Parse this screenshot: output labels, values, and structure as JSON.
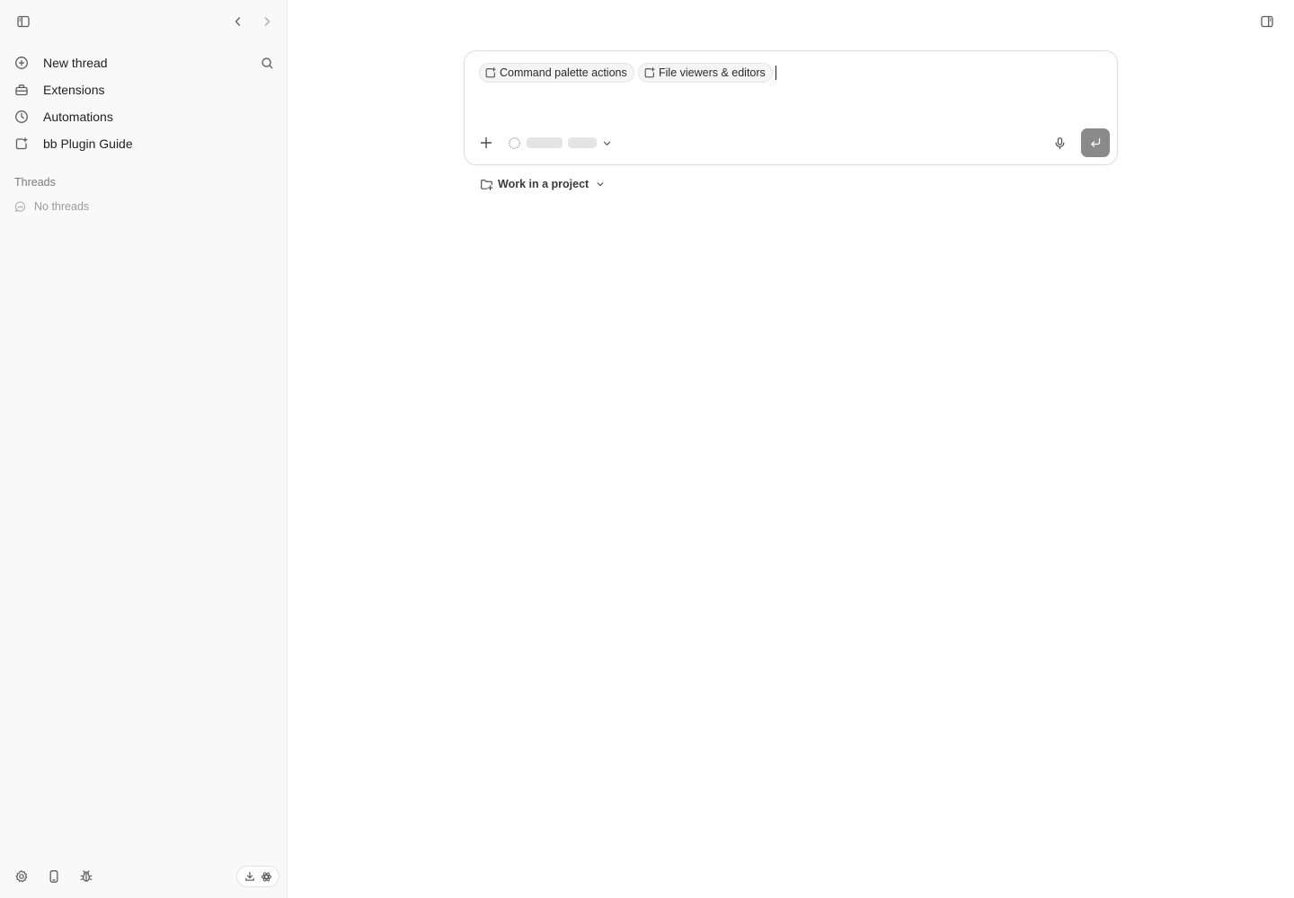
{
  "sidebar": {
    "nav": [
      {
        "label": "New thread",
        "icon": "plus-circle-icon"
      },
      {
        "label": "Extensions",
        "icon": "toolbox-icon"
      },
      {
        "label": "Automations",
        "icon": "clock-icon"
      },
      {
        "label": "bb Plugin Guide",
        "icon": "plugin-icon"
      }
    ],
    "threads_title": "Threads",
    "threads_empty": "No threads"
  },
  "composer": {
    "chips": [
      {
        "label": "Command palette actions",
        "icon": "plugin-icon"
      },
      {
        "label": "File viewers & editors",
        "icon": "plugin-icon"
      }
    ],
    "input_value": "",
    "model_loading": true
  },
  "project_selector": {
    "label": "Work in a project"
  },
  "colors": {
    "sidebar_bg": "#f9f9f9",
    "send_button": "#8a8a8a",
    "chip_bg": "#f5f5f5"
  }
}
